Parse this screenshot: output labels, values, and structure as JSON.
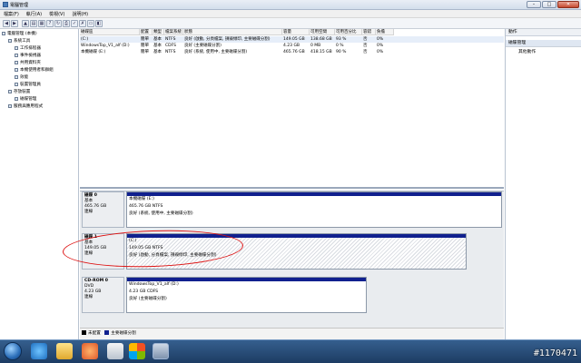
{
  "window": {
    "title": "電腦管理"
  },
  "menu": [
    "檔案(F)",
    "執行(A)",
    "檢視(V)",
    "說明(H)"
  ],
  "tree": [
    {
      "label": "電腦管理 (本機)",
      "indent": 0
    },
    {
      "label": "系統工具",
      "indent": 1
    },
    {
      "label": "工作排程器",
      "indent": 2
    },
    {
      "label": "事件檢視器",
      "indent": 2
    },
    {
      "label": "共用資料夾",
      "indent": 2
    },
    {
      "label": "本機使用者和群組",
      "indent": 2
    },
    {
      "label": "效能",
      "indent": 2
    },
    {
      "label": "裝置管理員",
      "indent": 2
    },
    {
      "label": "存放裝置",
      "indent": 1
    },
    {
      "label": "磁碟管理",
      "indent": 2
    },
    {
      "label": "服務與應用程式",
      "indent": 1
    }
  ],
  "volume_table": {
    "headers": [
      "磁碟區",
      "配置",
      "類型",
      "檔案系統",
      "狀態",
      "容量",
      "可用空間",
      "可用百分比",
      "容錯",
      "負擔"
    ],
    "rows": [
      [
        "(C:)",
        "簡單",
        "基本",
        "NTFS",
        "良好 (啟動, 分頁檔案, 損毀傾印, 主要磁碟分割)",
        "149.05 GB",
        "138.68 GB",
        "93 %",
        "否",
        "0%"
      ],
      [
        "WindowsTop_V1_alf (D:)",
        "簡單",
        "基本",
        "CDFS",
        "良好 (主要磁碟分割)",
        "4.23 GB",
        "0 MB",
        "0 %",
        "否",
        "0%"
      ],
      [
        "本機磁碟 (E:)",
        "簡單",
        "基本",
        "NTFS",
        "良好 (系統, 使用中, 主要磁碟分割)",
        "465.76 GB",
        "418.15 GB",
        "90 %",
        "否",
        "0%"
      ]
    ]
  },
  "disks": [
    {
      "name": "磁碟 0",
      "type": "基本",
      "size": "465.76 GB",
      "status": "連線",
      "partitions": [
        {
          "label": "本機磁碟 (E:)",
          "size": "465.76 GB NTFS",
          "status": "良好 (系統, 使用中, 主要磁碟分割)",
          "hatched": false
        }
      ]
    },
    {
      "name": "磁碟 1",
      "type": "基本",
      "size": "149.05 GB",
      "status": "連線",
      "partitions": [
        {
          "label": "(C:)",
          "size": "149.05 GB NTFS",
          "status": "良好 (啟動, 分頁檔案, 損毀傾印, 主要磁碟分割)",
          "hatched": true
        }
      ]
    },
    {
      "name": "CD-ROM 0",
      "type": "DVD",
      "size": "4.23 GB",
      "status": "連線",
      "partitions": [
        {
          "label": "WindowsTop_V1_alf (D:)",
          "size": "4.23 GB CDFS",
          "status": "良好 (主要磁碟分割)",
          "hatched": false
        }
      ]
    }
  ],
  "legend": [
    {
      "label": "未配置",
      "color": "#000000"
    },
    {
      "label": "主要磁碟分割",
      "color": "#10208e"
    }
  ],
  "actions": {
    "header": "動作",
    "section": "磁碟管理",
    "item": "其他動作"
  },
  "watermark": "#1170471",
  "colors": {
    "partition_band": "#10208e",
    "annotation": "#dd1111",
    "taskbar": "#1d3c63"
  }
}
